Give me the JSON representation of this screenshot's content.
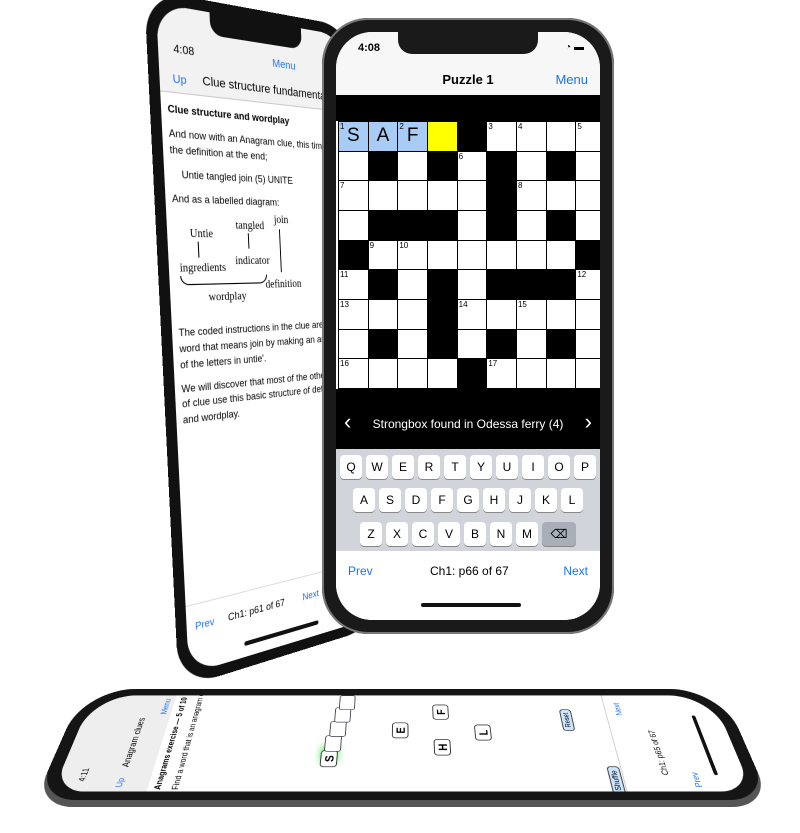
{
  "left_phone": {
    "time": "4:08",
    "title": "Clue structure fundamentals",
    "up": "Up",
    "menu": "Menu",
    "heading": "Clue structure and wordplay",
    "p1": "And now with an Anagram clue, this time with the definition at the end;",
    "example": "Untie tangled join (5) UNITE",
    "p2": "And as a labelled diagram:",
    "diagram": {
      "untie": "Untie",
      "tangled": "tangled",
      "join": "join",
      "ingredients": "ingredients",
      "indicator": "indicator",
      "wordplay": "wordplay",
      "definition": "definition"
    },
    "p3": "The coded instructions in the clue are 'find a word that means join by making an anagram of the letters in untie'.",
    "p4": "We will discover that most of the other types of clue use this basic structure of definition and wordplay.",
    "prev": "Prev",
    "page": "Ch1: p61 of 67",
    "next": "Next"
  },
  "right_phone": {
    "time": "4:08",
    "title": "Puzzle 1",
    "menu": "Menu",
    "grid": [
      [
        {
          "n": "1",
          "l": "S",
          "s": "h"
        },
        {
          "l": "A",
          "s": "h"
        },
        {
          "n": "2",
          "l": "F",
          "s": "h"
        },
        {
          "s": "y"
        },
        {
          "s": "b"
        },
        {
          "n": "3"
        },
        {
          "n": "4"
        },
        {},
        {
          "n": "5"
        }
      ],
      [
        {},
        {
          "s": "b"
        },
        {},
        {
          "s": "b"
        },
        {
          "n": "6"
        },
        {
          "s": "b"
        },
        {},
        {
          "s": "b"
        },
        {}
      ],
      [
        {
          "n": "7"
        },
        {},
        {},
        {},
        {},
        {
          "s": "b"
        },
        {
          "n": "8"
        },
        {},
        {}
      ],
      [
        {},
        {
          "s": "b"
        },
        {
          "s": "b"
        },
        {
          "s": "b"
        },
        {},
        {
          "s": "b"
        },
        {},
        {
          "s": "b"
        },
        {}
      ],
      [
        {
          "s": "b"
        },
        {
          "n": "9"
        },
        {
          "n": "10"
        },
        {},
        {},
        {},
        {},
        {},
        {
          "s": "b"
        }
      ],
      [
        {
          "n": "11"
        },
        {
          "s": "b"
        },
        {},
        {
          "s": "b"
        },
        {},
        {
          "s": "b"
        },
        {
          "s": "b"
        },
        {
          "s": "b"
        },
        {
          "n": "12"
        }
      ],
      [
        {
          "n": "13"
        },
        {},
        {},
        {
          "s": "b"
        },
        {
          "n": "14"
        },
        {},
        {
          "n": "15"
        },
        {},
        {}
      ],
      [
        {},
        {
          "s": "b"
        },
        {},
        {
          "s": "b"
        },
        {},
        {
          "s": "b"
        },
        {},
        {
          "s": "b"
        },
        {}
      ],
      [
        {
          "n": "16"
        },
        {},
        {},
        {},
        {
          "s": "b"
        },
        {
          "n": "17"
        },
        {},
        {},
        {}
      ]
    ],
    "clue": "Strongbox found in Odessa ferry (4)",
    "keyboard": [
      [
        "Q",
        "W",
        "E",
        "R",
        "T",
        "Y",
        "U",
        "I",
        "O",
        "P"
      ],
      [
        "A",
        "S",
        "D",
        "F",
        "G",
        "H",
        "J",
        "K",
        "L"
      ],
      [
        "Z",
        "X",
        "C",
        "V",
        "B",
        "N",
        "M",
        "⌫"
      ]
    ],
    "prev": "Prev",
    "page": "Ch1: p66 of 67",
    "next": "Next",
    "colors": {
      "highlight": "#a8ccf5",
      "cursor": "#ffff00",
      "link": "#1a73f0"
    }
  },
  "bottom_phone": {
    "time": "4:11",
    "up": "Up",
    "menu": "Menu",
    "title": "Anagram clues",
    "exercise": "Anagrams exercise — 5 of 10",
    "prompt": "Find a word that is an anagram of: flesh",
    "answer_letter": "S",
    "tiles": [
      "E",
      "F",
      "L",
      "H"
    ],
    "reset": "Reset",
    "shuffle": "Shuffle",
    "next": "Next",
    "prev": "Prev",
    "page": "Ch1: p65 of 67"
  }
}
